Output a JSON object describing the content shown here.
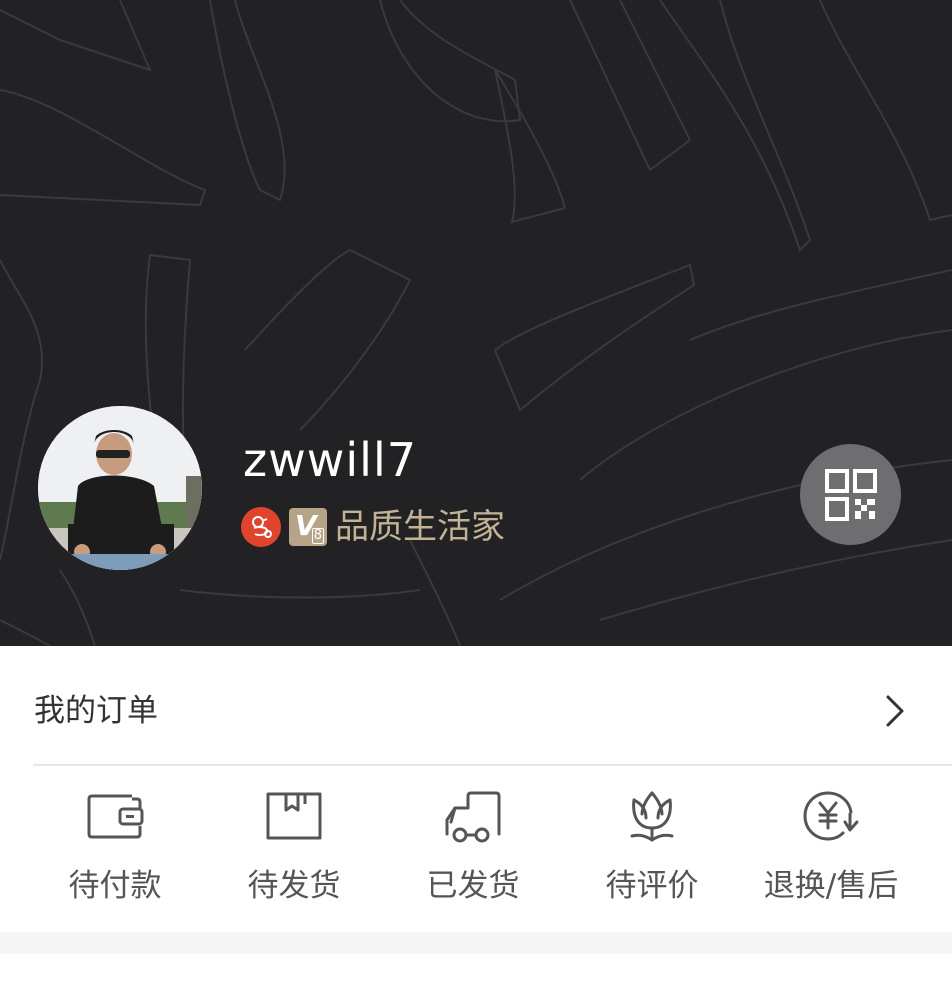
{
  "profile": {
    "username": "zwwill7",
    "badge_text": "品质生活家",
    "vip_letter": "V",
    "vip_number": "8",
    "level_icon": "level-badge-icon",
    "qr_icon": "qr-code-icon"
  },
  "orders": {
    "title": "我的订单",
    "items": [
      {
        "label": "待付款",
        "icon": "wallet-icon"
      },
      {
        "label": "待发货",
        "icon": "package-icon"
      },
      {
        "label": "已发货",
        "icon": "truck-icon"
      },
      {
        "label": "待评价",
        "icon": "tulip-icon"
      },
      {
        "label": "退换/售后",
        "icon": "refund-icon"
      }
    ]
  },
  "colors": {
    "header_bg": "#222124",
    "badge_gold": "#c3b395",
    "level_red": "#e0442d"
  }
}
